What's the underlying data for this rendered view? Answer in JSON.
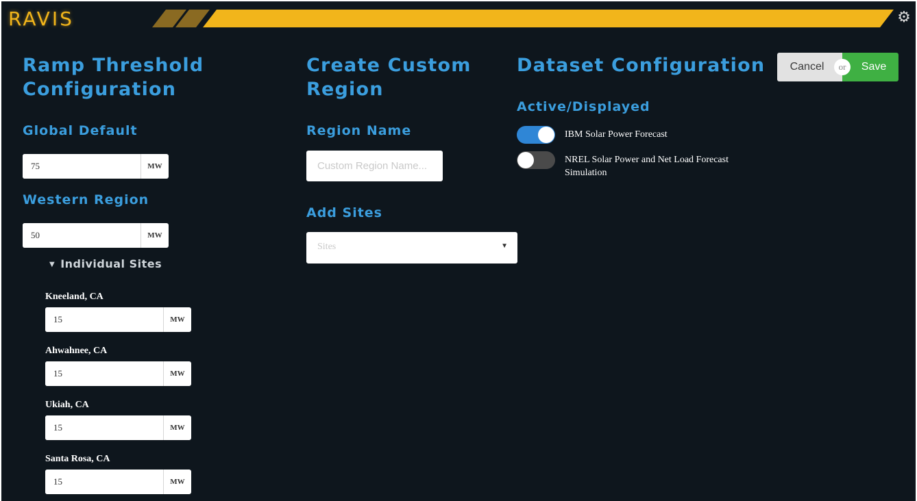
{
  "header": {
    "logo": "RAVIS",
    "colors": {
      "accent": "#f2b51b",
      "background": "#0e161d",
      "heading": "#3b9ede"
    },
    "settings_icon": "gear-icon"
  },
  "ramp": {
    "title_line1": "Ramp Threshold",
    "title_line2": "Configuration",
    "global_default_label": "Global Default",
    "global_default_value": "75",
    "western_region_label": "Western Region",
    "western_region_value": "50",
    "unit": "MW",
    "individual_sites_label": "Individual Sites",
    "sites": [
      {
        "name": "Kneeland, CA",
        "value": "15"
      },
      {
        "name": "Ahwahnee, CA",
        "value": "15"
      },
      {
        "name": "Ukiah, CA",
        "value": "15"
      },
      {
        "name": "Santa Rosa, CA",
        "value": "15"
      }
    ]
  },
  "custom_region": {
    "title_line1": "Create Custom",
    "title_line2": "Region",
    "region_name_label": "Region Name",
    "region_name_placeholder": "Custom Region Name...",
    "add_sites_label": "Add Sites",
    "sites_placeholder": "Sites"
  },
  "dataset": {
    "title": "Dataset Configuration",
    "active_label": "Active/Displayed",
    "datasets": [
      {
        "label": "IBM Solar Power Forecast",
        "enabled": true
      },
      {
        "label": "NREL Solar Power and Net Load Forecast Simulation",
        "enabled": false
      }
    ]
  },
  "actions": {
    "cancel_label": "Cancel",
    "or_label": "or",
    "save_label": "Save",
    "save_color": "#3fb043"
  }
}
